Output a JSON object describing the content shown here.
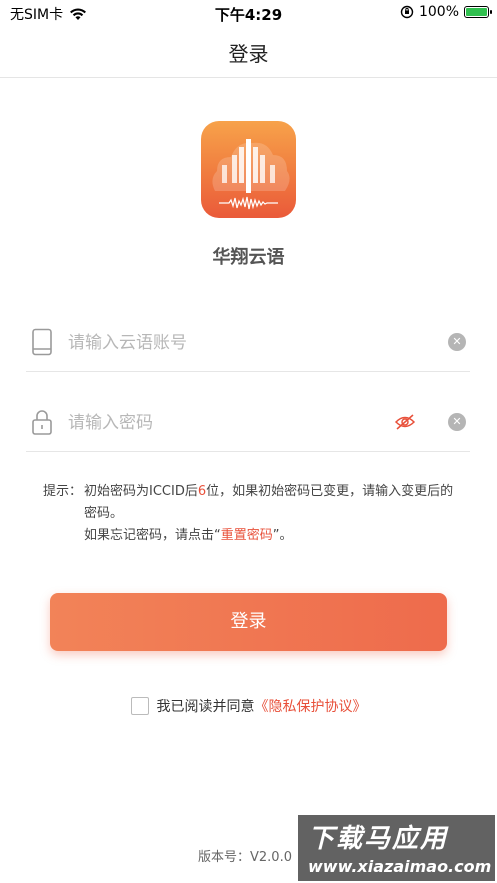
{
  "status_bar": {
    "carrier": "无SIM卡",
    "time": "下午4:29",
    "battery": "100%",
    "battery_level": 1.0
  },
  "nav": {
    "title": "登录"
  },
  "app": {
    "name": "华翔云语"
  },
  "account": {
    "placeholder": "请输入云语账号",
    "value": ""
  },
  "password": {
    "placeholder": "请输入密码",
    "value": ""
  },
  "hint": {
    "label": "提示：",
    "line1_a": "初始密码为ICCID后",
    "line1_num": "6",
    "line1_b": "位，如果初始密码已变更，请输入变更后的密码。",
    "line2_a": "如果忘记密码，请点击“",
    "line2_link": "重置密码",
    "line2_b": "”。"
  },
  "login_button": {
    "label": "登录"
  },
  "agreement": {
    "text": "我已阅读并同意",
    "link": "《隐私保护协议》",
    "checked": false
  },
  "version": {
    "text": "版本号：V2.0.0"
  },
  "watermark": {
    "top": "下载马应用",
    "bottom": "www.xiazaimao.com"
  },
  "colors": {
    "accent": "#ee6b4c",
    "link": "#e8503a",
    "placeholder": "#b7b7b7"
  }
}
